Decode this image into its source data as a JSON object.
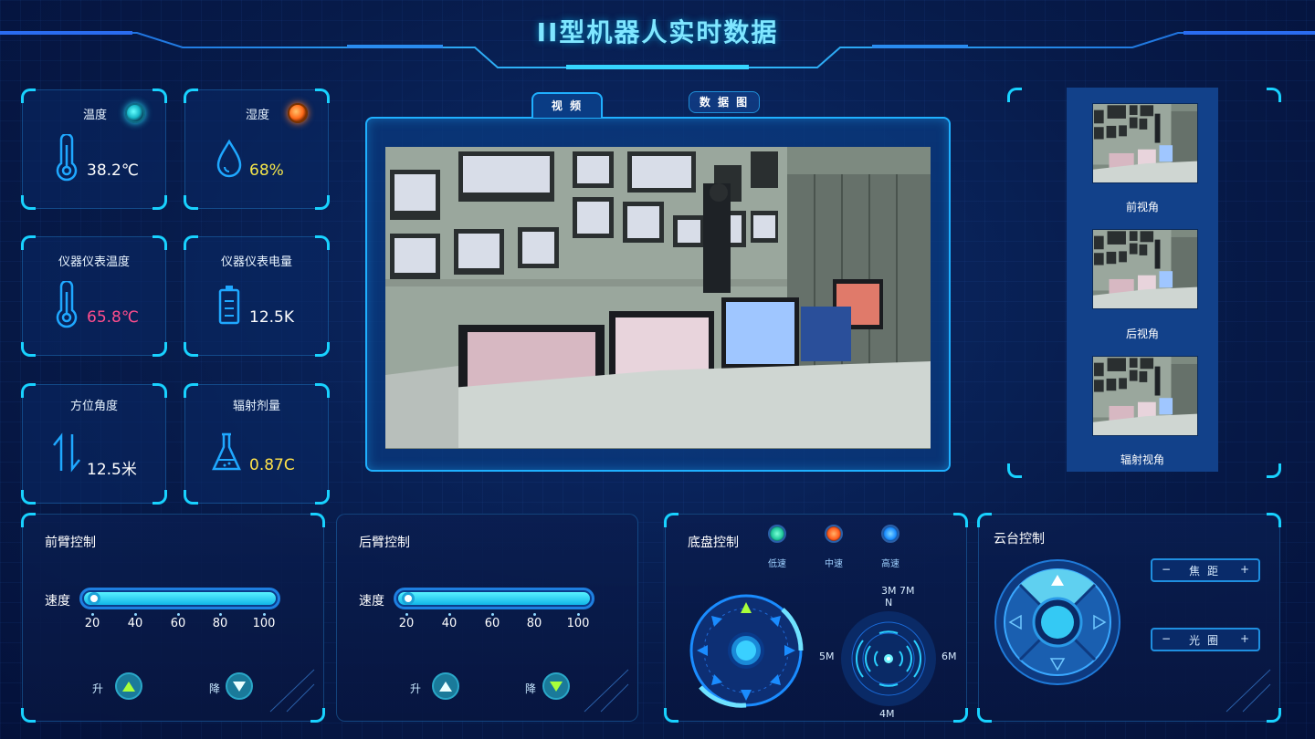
{
  "header": {
    "title": "II型机器人实时数据"
  },
  "sensors": [
    {
      "label": "温度",
      "value": "38.2℃",
      "icon": "thermometer-icon",
      "indicator": "cyan"
    },
    {
      "label": "湿度",
      "value": "68%",
      "icon": "water-drop-icon",
      "indicator": "orange"
    },
    {
      "label": "仪器仪表温度",
      "value": "65.8℃",
      "icon": "thermometer-icon"
    },
    {
      "label": "仪器仪表电量",
      "value": "12.5K",
      "icon": "battery-icon"
    },
    {
      "label": "方位角度",
      "value": "12.5米",
      "icon": "up-down-arrows-icon"
    },
    {
      "label": "辐射剂量",
      "value": "0.87C",
      "icon": "flask-icon"
    }
  ],
  "video": {
    "tabs": [
      {
        "label": "视 频",
        "active": true
      },
      {
        "label": "数 据 图",
        "active": false
      }
    ]
  },
  "cameras": [
    {
      "label": "前视角"
    },
    {
      "label": "后视角"
    },
    {
      "label": "辐射视角"
    }
  ],
  "front_arm": {
    "title": "前臂控制",
    "speed_label": "速度",
    "ticks": [
      "20",
      "40",
      "60",
      "80",
      "100"
    ],
    "up_label": "升",
    "down_label": "降",
    "speed_fraction": 0.0
  },
  "rear_arm": {
    "title": "后臂控制",
    "speed_label": "速度",
    "ticks": [
      "20",
      "40",
      "60",
      "80",
      "100"
    ],
    "up_label": "升",
    "down_label": "降",
    "speed_fraction": 0.0
  },
  "chassis": {
    "title": "底盘控制",
    "speeds": [
      {
        "label": "低速",
        "color": "#1fc79a"
      },
      {
        "label": "中速",
        "color": "#ff5a1a"
      },
      {
        "label": "高速",
        "color": "#1a8cff"
      }
    ],
    "radar": {
      "top": "3M 7M",
      "north": "N",
      "left": "5M",
      "right": "6M",
      "bottom": "4M"
    }
  },
  "gimbal": {
    "title": "云台控制",
    "focus": {
      "minus": "−",
      "label": "焦距",
      "plus": "+"
    },
    "aperture": {
      "minus": "−",
      "label": "光圈",
      "plus": "+"
    }
  },
  "colors": {
    "accent": "#18d2ff",
    "title": "#7fe6ff",
    "panel_border": "#1fb0ff"
  }
}
